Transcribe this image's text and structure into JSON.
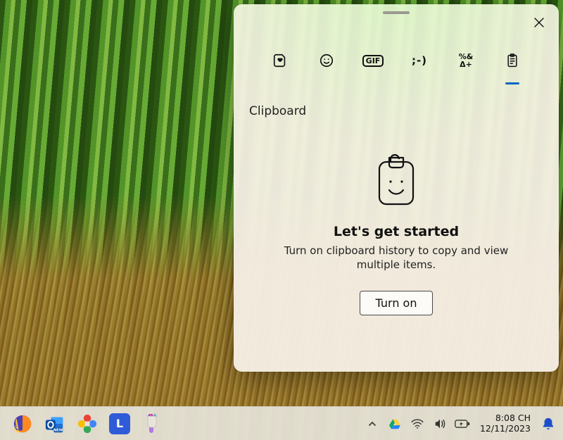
{
  "panel": {
    "tabs": [
      {
        "name": "recent",
        "icon": "heart-note-icon"
      },
      {
        "name": "emoji",
        "icon": "smile-icon"
      },
      {
        "name": "gif",
        "label": "GIF"
      },
      {
        "name": "kaomoji",
        "label": ";-)"
      },
      {
        "name": "symbols",
        "label": "%&\nΔ+"
      },
      {
        "name": "clipboard",
        "icon": "clipboard-icon",
        "active": true
      }
    ],
    "section_title": "Clipboard",
    "empty": {
      "heading": "Let's get started",
      "body": "Turn on clipboard history to copy and view multiple items.",
      "button": "Turn on"
    },
    "close_label": "Close"
  },
  "taskbar": {
    "apps": [
      {
        "name": "firefox"
      },
      {
        "name": "outlook"
      },
      {
        "name": "google-photos"
      },
      {
        "name": "L-app",
        "letter": "L"
      },
      {
        "name": "paint"
      }
    ],
    "tray": {
      "overflow": "˄",
      "drive": true,
      "wifi": true,
      "volume": true,
      "battery": true
    },
    "clock": {
      "time": "8:08 CH",
      "date": "12/11/2023"
    }
  },
  "colors": {
    "accent": "#0067c0"
  }
}
